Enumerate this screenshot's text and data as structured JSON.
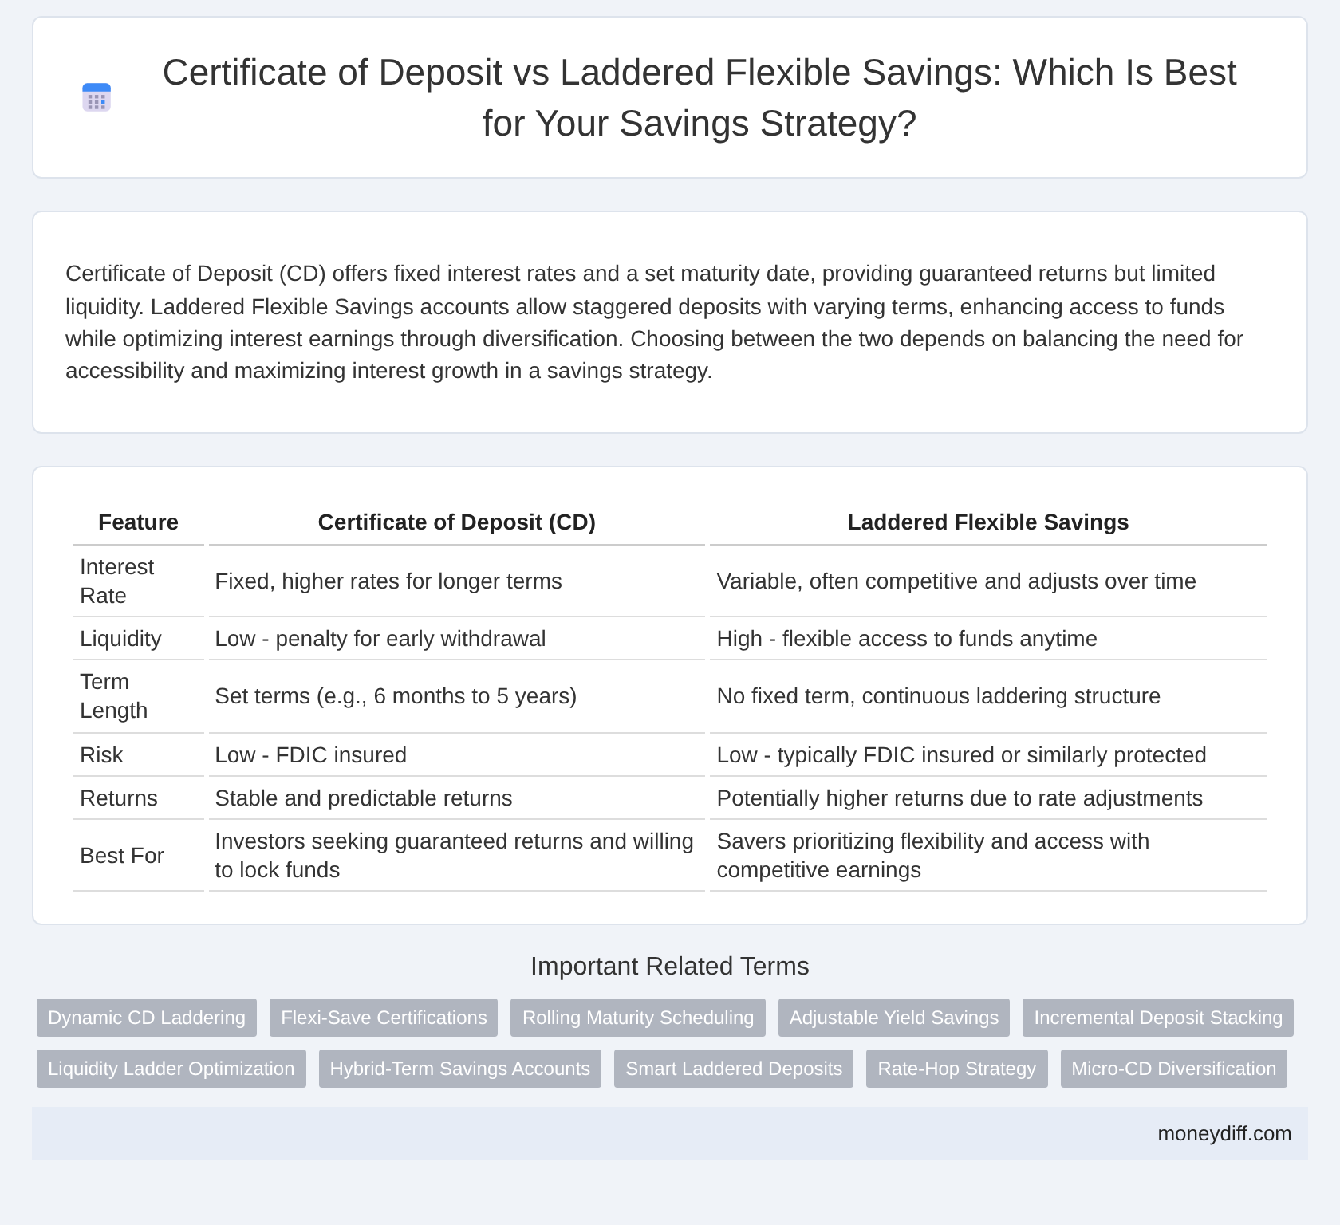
{
  "header": {
    "title": "Certificate of Deposit vs Laddered Flexible Savings: Which Is Best for Your Savings Strategy?"
  },
  "intro": "Certificate of Deposit (CD) offers fixed interest rates and a set maturity date, providing guaranteed returns but limited liquidity. Laddered Flexible Savings accounts allow staggered deposits with varying terms, enhancing access to funds while optimizing interest earnings through diversification. Choosing between the two depends on balancing the need for accessibility and maximizing interest growth in a savings strategy.",
  "table": {
    "columns": [
      "Feature",
      "Certificate of Deposit (CD)",
      "Laddered Flexible Savings"
    ],
    "rows": [
      [
        "Interest Rate",
        "Fixed, higher rates for longer terms",
        "Variable, often competitive and adjusts over time"
      ],
      [
        "Liquidity",
        "Low - penalty for early withdrawal",
        "High - flexible access to funds anytime"
      ],
      [
        "Term Length",
        "Set terms (e.g., 6 months to 5 years)",
        "No fixed term, continuous laddering structure"
      ],
      [
        "Risk",
        "Low - FDIC insured",
        "Low - typically FDIC insured or similarly protected"
      ],
      [
        "Returns",
        "Stable and predictable returns",
        "Potentially higher returns due to rate adjustments"
      ],
      [
        "Best For",
        "Investors seeking guaranteed returns and willing to lock funds",
        "Savers prioritizing flexibility and access with competitive earnings"
      ]
    ]
  },
  "related": {
    "title": "Important Related Terms",
    "tags": [
      "Dynamic CD Laddering",
      "Flexi-Save Certifications",
      "Rolling Maturity Scheduling",
      "Adjustable Yield Savings",
      "Incremental Deposit Stacking",
      "Liquidity Ladder Optimization",
      "Hybrid-Term Savings Accounts",
      "Smart Laddered Deposits",
      "Rate-Hop Strategy",
      "Micro-CD Diversification"
    ]
  },
  "footer": {
    "site": "moneydiff.com"
  }
}
